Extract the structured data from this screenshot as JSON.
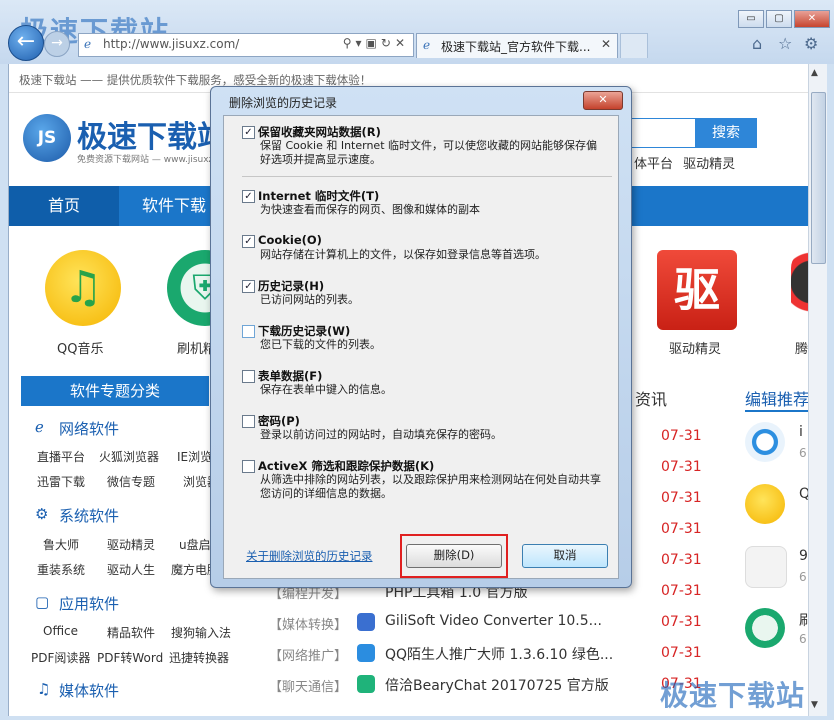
{
  "browser": {
    "watermark": "极速下载站",
    "url": "http://www.jisuxz.com/",
    "tab_title": "极速下载站_官方软件下载...",
    "win_min": "▭",
    "win_max": "▢",
    "win_close": "✕"
  },
  "page": {
    "slogan": "极速下载站 —— 提供优质软件下载服务，感受全新的极速下载体验！",
    "logo_badge": "JS",
    "logo_text": "极速下载站",
    "logo_sub": "免费资源下载网站 — www.jisuxz.com",
    "search_btn": "搜索",
    "hot_links": "体平台  驱动精灵",
    "nav": [
      "首页",
      "软件下载"
    ],
    "apps": [
      {
        "label": "QQ音乐"
      },
      {
        "label": "刷机精灵"
      },
      {
        "label": "驱动精灵"
      },
      {
        "label": "腾"
      }
    ],
    "qudong_glyph": "驱",
    "topic_bar": "软件专题分类",
    "categories": [
      {
        "title": "网络软件",
        "icon": "ℯ",
        "links": [
          [
            "直播平台",
            "火狐浏览器",
            "IE浏览器"
          ],
          [
            "迅雷下载",
            "微信专题",
            "浏览器"
          ]
        ]
      },
      {
        "title": "系统软件",
        "icon": "⚙",
        "links": [
          [
            "鲁大师",
            "驱动精灵",
            "u盘启动"
          ],
          [
            "重装系统",
            "驱动人生",
            "魔方电脑"
          ]
        ]
      },
      {
        "title": "应用软件",
        "icon": "▢",
        "links": [
          [
            "Office",
            "精品软件",
            "搜狗输入法"
          ],
          [
            "PDF阅读器",
            "PDF转Word",
            "迅捷转换器"
          ]
        ]
      },
      {
        "title": "媒体软件",
        "icon": "♫",
        "links": []
      }
    ],
    "zixun": "资讯",
    "edit_rec": "编辑推荐",
    "dates": [
      "07-31",
      "07-31",
      "07-31",
      "07-31",
      "07-31",
      "07-31",
      "07-31",
      "07-31",
      "07-31"
    ],
    "rows": [
      {
        "tag": "【编程开发】",
        "title": "PHP工具箱 1.0 官方版"
      },
      {
        "tag": "【媒体转换】",
        "title": "GiliSoft Video Converter 10.5..."
      },
      {
        "tag": "【网络推广】",
        "title": "QQ陌生人推广大师 1.3.6.10 绿色..."
      },
      {
        "tag": "【聊天通信】",
        "title": "倍洽BearyChat 20170725 官方版"
      }
    ],
    "side_items": [
      "i",
      "Q",
      "9",
      "刷",
      ""
    ],
    "side_sub": [
      "6",
      "",
      "6",
      "6",
      ""
    ]
  },
  "dialog": {
    "title": "删除浏览的历史记录",
    "close": "✕",
    "options": [
      {
        "title": "保留收藏夹网站数据(R)",
        "desc": "保留 Cookie 和 Internet 临时文件，可以使您收藏的网站能够保存偏好选项并提高显示速度。",
        "checked": true
      },
      {
        "title": "Internet 临时文件(T)",
        "desc": "为快速查看而保存的网页、图像和媒体的副本",
        "checked": true
      },
      {
        "title": "Cookie(O)",
        "desc": "网站存储在计算机上的文件，以保存如登录信息等首选项。",
        "checked": true
      },
      {
        "title": "历史记录(H)",
        "desc": "已访问网站的列表。",
        "checked": true
      },
      {
        "title": "下载历史记录(W)",
        "desc": "您已下载的文件的列表。",
        "checked": false
      },
      {
        "title": "表单数据(F)",
        "desc": "保存在表单中键入的信息。",
        "checked": false
      },
      {
        "title": "密码(P)",
        "desc": "登录以前访问过的网站时，自动填充保存的密码。",
        "checked": false
      },
      {
        "title": "ActiveX 筛选和跟踪保护数据(K)",
        "desc": "从筛选中排除的网站列表，以及跟踪保护用来检测网站在何处自动共享您访问的详细信息的数据。",
        "checked": false
      }
    ],
    "check_mark": "✓",
    "about_link": "关于删除浏览的历史记录",
    "delete_btn": "删除(D)",
    "cancel_btn": "取消"
  },
  "watermark_bottom": "极速下载站"
}
